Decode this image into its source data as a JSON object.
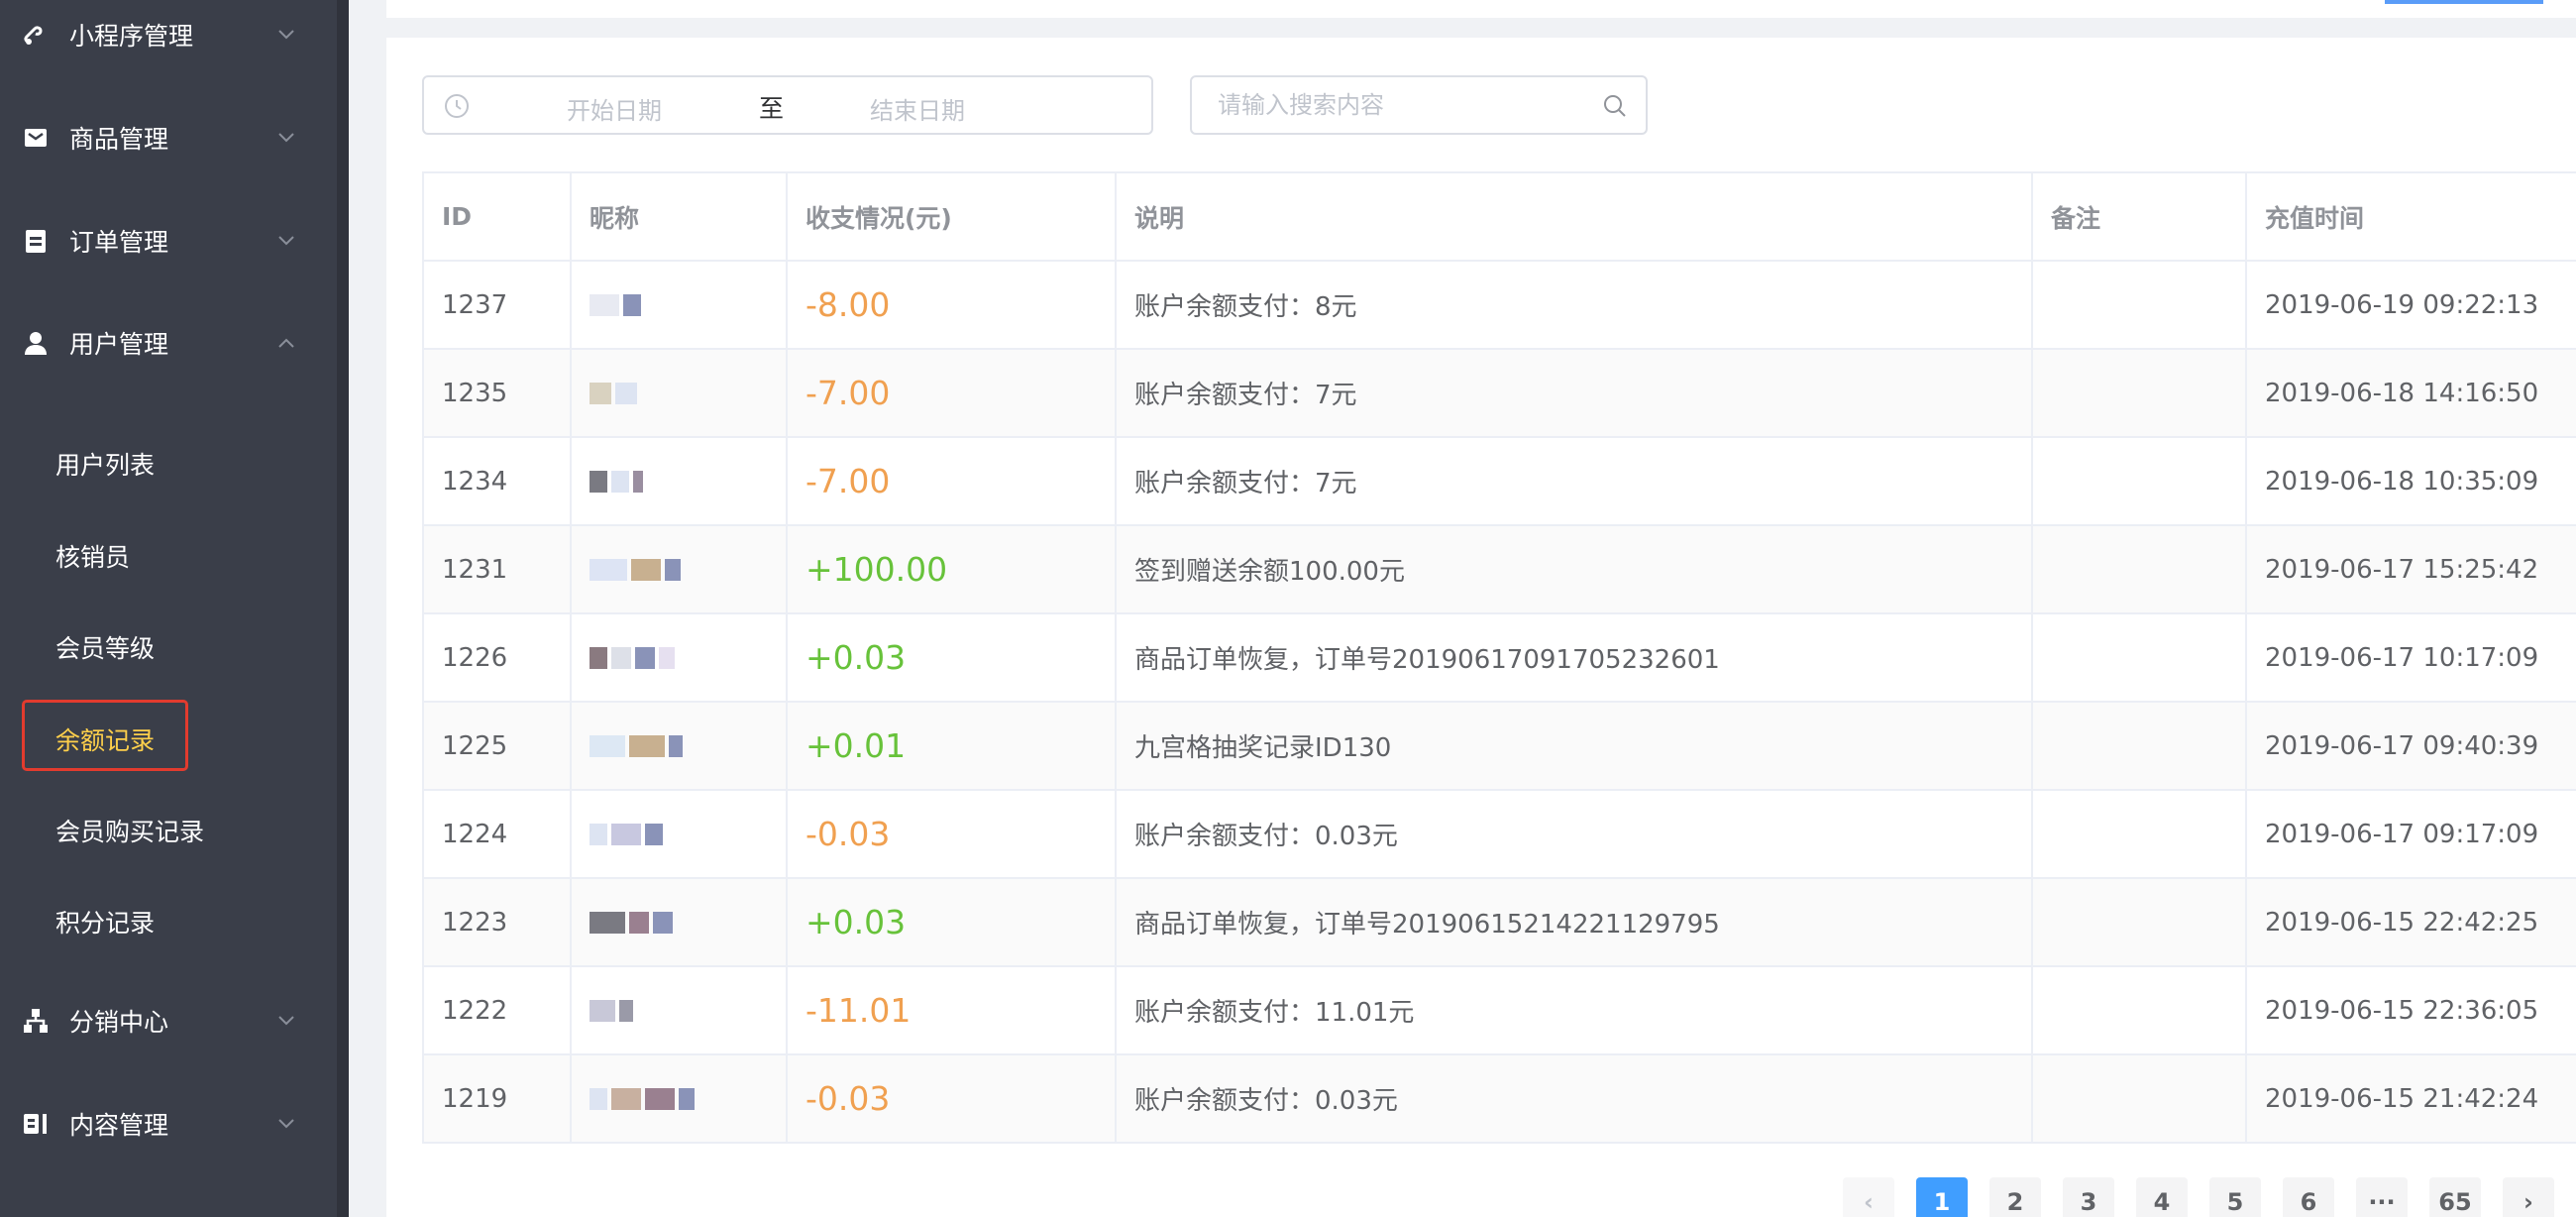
{
  "sidebar": {
    "groups": [
      {
        "label": "小程序管理",
        "icon": "miniapp-icon"
      },
      {
        "label": "商品管理",
        "icon": "goods-icon"
      },
      {
        "label": "订单管理",
        "icon": "order-icon"
      },
      {
        "label": "用户管理",
        "icon": "user-icon"
      },
      {
        "label": "分销中心",
        "icon": "distribution-icon"
      },
      {
        "label": "内容管理",
        "icon": "content-icon"
      }
    ],
    "sub_items": [
      {
        "label": "用户列表"
      },
      {
        "label": "核销员"
      },
      {
        "label": "会员等级"
      },
      {
        "label": "余额记录"
      },
      {
        "label": "会员购买记录"
      },
      {
        "label": "积分记录"
      }
    ],
    "active_item": "余额记录"
  },
  "filters": {
    "start_placeholder": "开始日期",
    "separator": "至",
    "end_placeholder": "结束日期",
    "search_placeholder": "请输入搜索内容"
  },
  "table": {
    "headers": [
      "ID",
      "昵称",
      "收支情况(元)",
      "说明",
      "备注",
      "充值时间"
    ],
    "rows": [
      {
        "id": "1237",
        "amount": "-8.00",
        "desc": "账户余额支付：8元",
        "note": "",
        "time": "2019-06-19 09:22:13"
      },
      {
        "id": "1235",
        "amount": "-7.00",
        "desc": "账户余额支付：7元",
        "note": "",
        "time": "2019-06-18 14:16:50"
      },
      {
        "id": "1234",
        "amount": "-7.00",
        "desc": "账户余额支付：7元",
        "note": "",
        "time": "2019-06-18 10:35:09"
      },
      {
        "id": "1231",
        "amount": "+100.00",
        "desc": "签到赠送余额100.00元",
        "note": "",
        "time": "2019-06-17 15:25:42"
      },
      {
        "id": "1226",
        "amount": "+0.03",
        "desc": "商品订单恢复，订单号20190617091705232601",
        "note": "",
        "time": "2019-06-17 10:17:09"
      },
      {
        "id": "1225",
        "amount": "+0.01",
        "desc": "九宫格抽奖记录ID130",
        "note": "",
        "time": "2019-06-17 09:40:39"
      },
      {
        "id": "1224",
        "amount": "-0.03",
        "desc": "账户余额支付：0.03元",
        "note": "",
        "time": "2019-06-17 09:17:09"
      },
      {
        "id": "1223",
        "amount": "+0.03",
        "desc": "商品订单恢复，订单号20190615214221129795",
        "note": "",
        "time": "2019-06-15 22:42:25"
      },
      {
        "id": "1222",
        "amount": "-11.01",
        "desc": "账户余额支付：11.01元",
        "note": "",
        "time": "2019-06-15 22:36:05"
      },
      {
        "id": "1219",
        "amount": "-0.03",
        "desc": "账户余额支付：0.03元",
        "note": "",
        "time": "2019-06-15 21:42:24"
      }
    ]
  },
  "pagination": {
    "prev": "‹",
    "pages": [
      "1",
      "2",
      "3",
      "4",
      "5",
      "6"
    ],
    "ellipsis": "···",
    "last": "65",
    "next": "›",
    "current": "1"
  },
  "colors": {
    "sidebar_bg": "#3a3e49",
    "active_text": "#ffd04b",
    "negative": "#f0a050",
    "positive": "#67c23a",
    "primary": "#409eff"
  }
}
